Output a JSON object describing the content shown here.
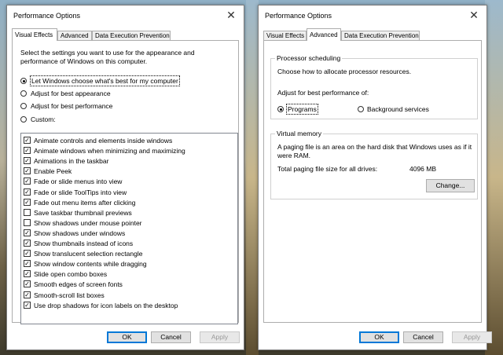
{
  "dialog1": {
    "title": "Performance Options",
    "tabs": [
      {
        "label": "Visual Effects",
        "active": true
      },
      {
        "label": "Advanced",
        "active": false
      },
      {
        "label": "Data Execution Prevention",
        "active": false
      }
    ],
    "intro_line1": "Select the settings you want to use for the appearance and",
    "intro_line2": "performance of Windows on this computer.",
    "radios": [
      {
        "label": "Let Windows choose what's best for my computer",
        "selected": true
      },
      {
        "label": "Adjust for best appearance",
        "selected": false
      },
      {
        "label": "Adjust for best performance",
        "selected": false
      },
      {
        "label": "Custom:",
        "selected": false
      }
    ],
    "effects": [
      {
        "label": "Animate controls and elements inside windows",
        "checked": true
      },
      {
        "label": "Animate windows when minimizing and maximizing",
        "checked": true
      },
      {
        "label": "Animations in the taskbar",
        "checked": true
      },
      {
        "label": "Enable Peek",
        "checked": true
      },
      {
        "label": "Fade or slide menus into view",
        "checked": true
      },
      {
        "label": "Fade or slide ToolTips into view",
        "checked": true
      },
      {
        "label": "Fade out menu items after clicking",
        "checked": true
      },
      {
        "label": "Save taskbar thumbnail previews",
        "checked": false
      },
      {
        "label": "Show shadows under mouse pointer",
        "checked": false
      },
      {
        "label": "Show shadows under windows",
        "checked": true
      },
      {
        "label": "Show thumbnails instead of icons",
        "checked": true
      },
      {
        "label": "Show translucent selection rectangle",
        "checked": true
      },
      {
        "label": "Show window contents while dragging",
        "checked": true
      },
      {
        "label": "Slide open combo boxes",
        "checked": true
      },
      {
        "label": "Smooth edges of screen fonts",
        "checked": true
      },
      {
        "label": "Smooth-scroll list boxes",
        "checked": true
      },
      {
        "label": "Use drop shadows for icon labels on the desktop",
        "checked": true
      }
    ],
    "buttons": {
      "ok": "OK",
      "cancel": "Cancel",
      "apply": "Apply"
    }
  },
  "dialog2": {
    "title": "Performance Options",
    "tabs": [
      {
        "label": "Visual Effects",
        "active": false
      },
      {
        "label": "Advanced",
        "active": true
      },
      {
        "label": "Data Execution Prevention",
        "active": false
      }
    ],
    "processor": {
      "group_title": "Processor scheduling",
      "description": "Choose how to allocate processor resources.",
      "adjust_label": "Adjust for best performance of:",
      "options": [
        {
          "label": "Programs",
          "selected": true
        },
        {
          "label": "Background services",
          "selected": false
        }
      ]
    },
    "memory": {
      "group_title": "Virtual memory",
      "desc_line1": "A paging file is an area on the hard disk that Windows uses as if it",
      "desc_line2": "were RAM.",
      "size_label": "Total paging file size for all drives:",
      "size_value": "4096 MB",
      "change_button": "Change..."
    },
    "buttons": {
      "ok": "OK",
      "cancel": "Cancel",
      "apply": "Apply"
    }
  },
  "icons": {
    "close": "✕",
    "check": "✓"
  }
}
